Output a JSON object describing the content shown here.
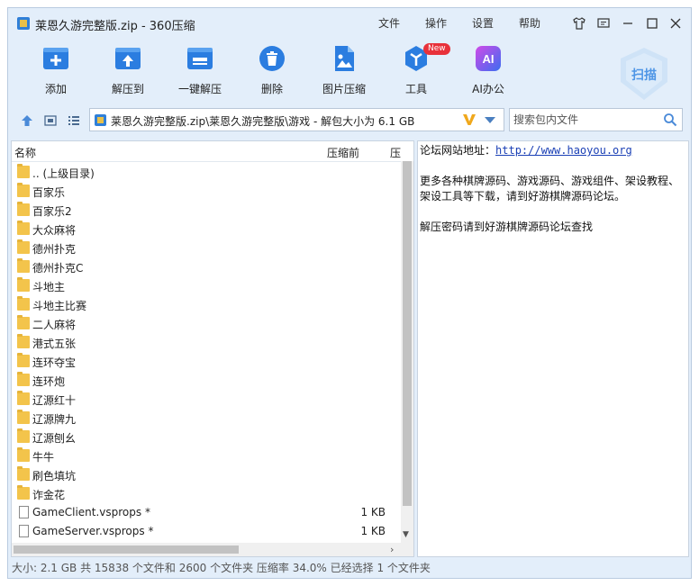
{
  "title": "莱恩久游完整版.zip - 360压缩",
  "menu": [
    "文件",
    "操作",
    "设置",
    "帮助"
  ],
  "toolbar": [
    {
      "label": "添加",
      "icon": "add-icon"
    },
    {
      "label": "解压到",
      "icon": "extract-to-icon"
    },
    {
      "label": "一键解压",
      "icon": "one-click-extract-icon"
    },
    {
      "label": "删除",
      "icon": "trash-icon"
    },
    {
      "label": "图片压缩",
      "icon": "image-compress-icon"
    },
    {
      "label": "工具",
      "icon": "tools-icon"
    },
    {
      "label": "AI办公",
      "icon": "ai-office-icon"
    }
  ],
  "tools_badge": "New",
  "ai_glyph": "AI",
  "scan_label": "扫描",
  "address": {
    "path": "莱恩久游完整版.zip\\莱恩久游完整版\\游戏 - 解包大小为 6.1 GB"
  },
  "search": {
    "placeholder": "搜索包内文件"
  },
  "columns": {
    "name": "名称",
    "before": "压缩前",
    "after": "压"
  },
  "files": [
    {
      "name": ".. (上级目录)",
      "type": "folder",
      "size": ""
    },
    {
      "name": "百家乐",
      "type": "folder",
      "size": ""
    },
    {
      "name": "百家乐2",
      "type": "folder",
      "size": ""
    },
    {
      "name": "大众麻将",
      "type": "folder",
      "size": ""
    },
    {
      "name": "德州扑克",
      "type": "folder",
      "size": ""
    },
    {
      "name": "德州扑克C",
      "type": "folder",
      "size": ""
    },
    {
      "name": "斗地主",
      "type": "folder",
      "size": ""
    },
    {
      "name": "斗地主比赛",
      "type": "folder",
      "size": ""
    },
    {
      "name": "二人麻将",
      "type": "folder",
      "size": ""
    },
    {
      "name": "港式五张",
      "type": "folder",
      "size": ""
    },
    {
      "name": "连环夺宝",
      "type": "folder",
      "size": ""
    },
    {
      "name": "连环炮",
      "type": "folder",
      "size": ""
    },
    {
      "name": "辽源红十",
      "type": "folder",
      "size": ""
    },
    {
      "name": "辽源牌九",
      "type": "folder",
      "size": ""
    },
    {
      "name": "辽源刨幺",
      "type": "folder",
      "size": ""
    },
    {
      "name": "牛牛",
      "type": "folder",
      "size": ""
    },
    {
      "name": "刷色填坑",
      "type": "folder",
      "size": ""
    },
    {
      "name": "诈金花",
      "type": "folder",
      "size": ""
    },
    {
      "name": "GameClient.vsprops *",
      "type": "file",
      "size": "1 KB"
    },
    {
      "name": "GameServer.vsprops *",
      "type": "file",
      "size": "1 KB"
    }
  ],
  "comment": {
    "line1_prefix": "论坛网站地址：",
    "line1_link": "http://www.haoyou.org",
    "line2": "更多各种棋牌源码、游戏源码、游戏组件、架设教程、",
    "line3": "架设工具等下载，请到好游棋牌源码论坛。",
    "line4": "解压密码请到好游棋牌源码论坛查找"
  },
  "status": "大小: 2.1 GB 共 15838 个文件和 2600 个文件夹 压缩率 34.0% 已经选择 1 个文件夹"
}
